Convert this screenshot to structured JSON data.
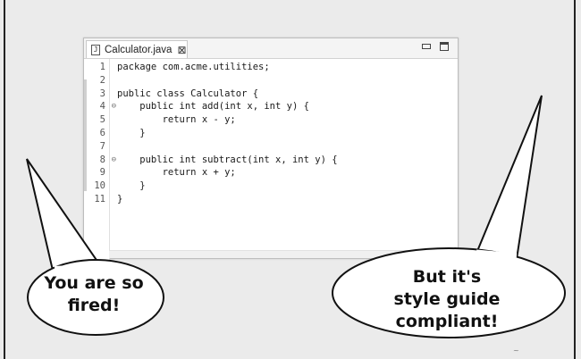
{
  "editor": {
    "tab": {
      "file_icon_glyph": "J",
      "title": "Calculator.java",
      "close_glyph": "⊠"
    },
    "line_numbers": [
      "1",
      "2",
      "3",
      "4",
      "5",
      "6",
      "7",
      "8",
      "9",
      "10",
      "11"
    ],
    "fold_markers": {
      "4": "⊖",
      "8": "⊖"
    },
    "code_lines": [
      "package com.acme.utilities;",
      "",
      "public class Calculator {",
      "    public int add(int x, int y) {",
      "        return x - y;",
      "    }",
      "",
      "    public int subtract(int x, int y) {",
      "        return x + y;",
      "    }",
      "}"
    ]
  },
  "bubbles": {
    "left": {
      "line1": "You are so",
      "line2": "fired!"
    },
    "right": {
      "line1": "But it's",
      "line2": "style guide compliant!"
    }
  },
  "colors": {
    "background": "#ebebeb",
    "editor_bg": "#ffffff",
    "ink": "#111111"
  },
  "icons": [
    "file-icon",
    "close-icon",
    "minimize-icon",
    "maximize-icon",
    "fold-icon"
  ]
}
